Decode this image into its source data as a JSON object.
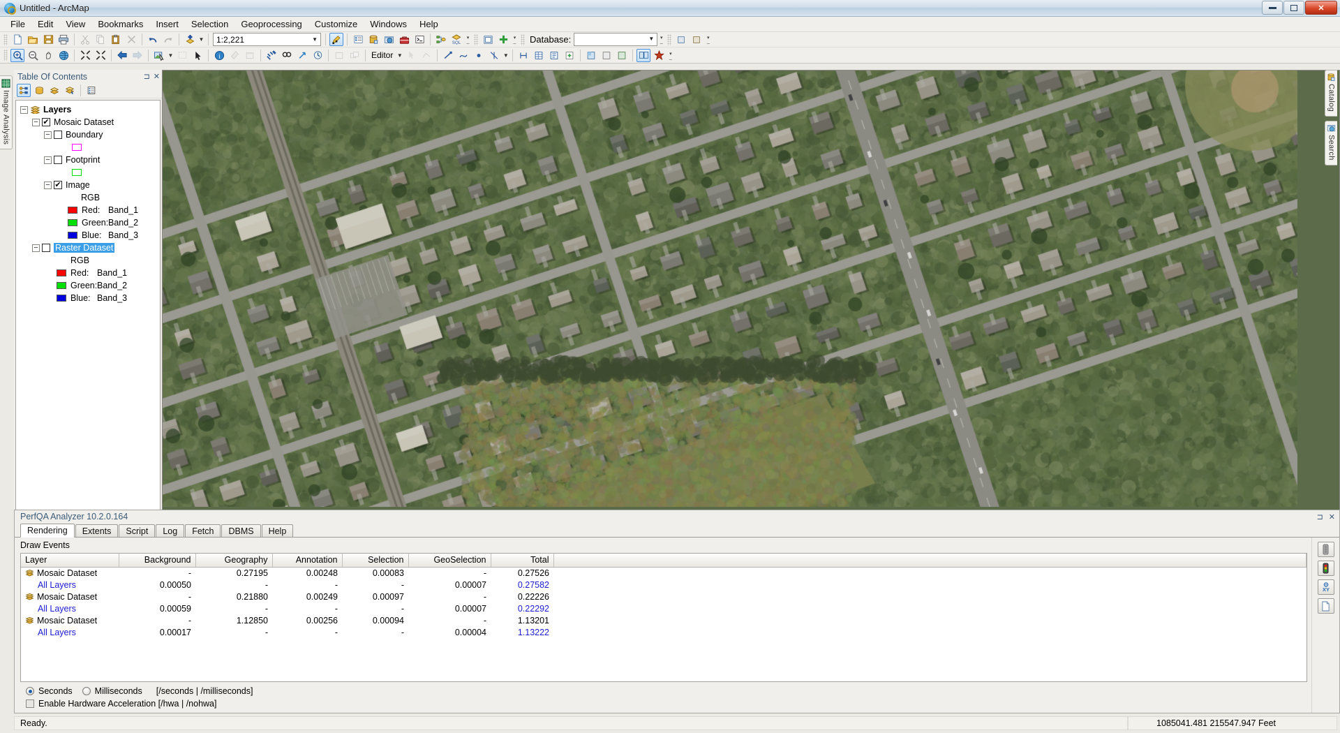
{
  "window": {
    "title": "Untitled - ArcMap",
    "app_icon": "arcmap-globe-icon",
    "minimize": "minimize-icon",
    "maximize": "restore-icon",
    "close": "✕"
  },
  "menubar": {
    "items": [
      {
        "label": "File"
      },
      {
        "label": "Edit"
      },
      {
        "label": "View"
      },
      {
        "label": "Bookmarks"
      },
      {
        "label": "Insert"
      },
      {
        "label": "Selection"
      },
      {
        "label": "Geoprocessing"
      },
      {
        "label": "Customize"
      },
      {
        "label": "Windows"
      },
      {
        "label": "Help"
      }
    ]
  },
  "toolbar_standard": {
    "scale_value": "1:2,221",
    "database_label": "Database:",
    "database_value": "",
    "buttons": [
      "new-map-icon",
      "open-icon",
      "save-icon",
      "print-icon",
      "cut-icon",
      "copy-icon",
      "paste-icon",
      "delete-icon",
      "undo-icon",
      "redo-icon",
      "add-data-icon",
      "editor-toolbar-icon",
      "table-of-contents-icon",
      "catalog-icon",
      "search-icon",
      "toolbox-icon",
      "python-window-icon",
      "model-builder-icon",
      "sql-icon",
      "layout-view-icon",
      "add-icon"
    ]
  },
  "toolbar_tools": {
    "editor_label": "Editor",
    "buttons": [
      "zoom-in-icon",
      "zoom-out-icon",
      "pan-icon",
      "full-extent-icon",
      "fixed-zoom-in-icon",
      "fixed-zoom-out-icon",
      "back-extent-icon",
      "forward-extent-icon",
      "select-features-icon",
      "clear-selection-icon",
      "select-elements-icon",
      "identify-icon",
      "hyperlink-icon",
      "html-popup-icon",
      "measure-icon",
      "find-icon",
      "go-to-xy-icon",
      "time-slider-icon",
      "create-viewer-icon",
      "swipe-icon"
    ]
  },
  "sidebar_left": {
    "tabs": [
      {
        "label": "Image Analysis",
        "icon": "image-analysis-icon"
      }
    ]
  },
  "sidebar_right": {
    "tabs": [
      {
        "label": "Catalog",
        "icon": "catalog-icon"
      },
      {
        "label": "Search",
        "icon": "search-icon"
      }
    ]
  },
  "toc": {
    "title": "Table Of Contents",
    "pin_icon": "pin-icon",
    "close_icon": "close-icon",
    "toolbar_buttons": [
      "list-by-drawing-order-icon",
      "list-by-source-icon",
      "list-by-visibility-icon",
      "list-by-selection-icon",
      "options-icon"
    ],
    "tree": [
      {
        "label": "Layers",
        "indent": 0,
        "type": "group",
        "expander": "−",
        "icon": "layers-icon",
        "bold": true
      },
      {
        "label": "Mosaic Dataset",
        "indent": 1,
        "type": "layer",
        "expander": "−",
        "checked": true
      },
      {
        "label": "Boundary",
        "indent": 2,
        "type": "layer",
        "expander": "−",
        "checked": false
      },
      {
        "label": "",
        "indent": 3,
        "type": "swatch",
        "color": "#ff00ff"
      },
      {
        "label": "Footprint",
        "indent": 2,
        "type": "layer",
        "expander": "−",
        "checked": false
      },
      {
        "label": "",
        "indent": 3,
        "type": "swatch",
        "color": "#00e000"
      },
      {
        "label": "Image",
        "indent": 2,
        "type": "layer",
        "expander": "−",
        "checked": true
      },
      {
        "label": "RGB",
        "indent": 4,
        "type": "text"
      },
      {
        "label": "Red:",
        "value": "Band_1",
        "indent": 3,
        "type": "band",
        "color": "#ff0000"
      },
      {
        "label": "Green:",
        "value": "Band_2",
        "indent": 3,
        "type": "band",
        "color": "#00e000"
      },
      {
        "label": "Blue:",
        "value": "Band_3",
        "indent": 3,
        "type": "band",
        "color": "#0000e0"
      },
      {
        "label": "Raster Dataset",
        "indent": 1,
        "type": "layer",
        "expander": "−",
        "checked": false,
        "selected": true
      },
      {
        "label": "RGB",
        "indent": 3,
        "type": "text"
      },
      {
        "label": "Red:",
        "value": "Band_1",
        "indent": 2,
        "type": "band",
        "color": "#ff0000"
      },
      {
        "label": "Green:",
        "value": "Band_2",
        "indent": 2,
        "type": "band",
        "color": "#00e000"
      },
      {
        "label": "Blue:",
        "value": "Band_3",
        "indent": 2,
        "type": "band",
        "color": "#0000e0"
      }
    ]
  },
  "perfqa": {
    "title": "PerfQA Analyzer 10.2.0.164",
    "pin_icon": "pin-icon",
    "close_icon": "close-icon",
    "tabs": [
      {
        "label": "Rendering",
        "selected": true
      },
      {
        "label": "Extents",
        "selected": false
      },
      {
        "label": "Script",
        "selected": false
      },
      {
        "label": "Log",
        "selected": false
      },
      {
        "label": "Fetch",
        "selected": false
      },
      {
        "label": "DBMS",
        "selected": false
      },
      {
        "label": "Help",
        "selected": false
      }
    ],
    "section_label": "Draw Events",
    "columns": [
      "Layer",
      "Background",
      "Geography",
      "Annotation",
      "Selection",
      "GeoSelection",
      "Total"
    ],
    "rows": [
      {
        "layer": "Mosaic Dataset",
        "icon": "mosaic-dataset-icon",
        "background": "-",
        "geography": "0.27195",
        "annotation": "0.00248",
        "selection": "0.00083",
        "geoselection": "-",
        "total": "0.27526",
        "style": "normal"
      },
      {
        "layer": "All Layers",
        "icon": "",
        "background": "0.00050",
        "geography": "-",
        "annotation": "-",
        "selection": "-",
        "geoselection": "0.00007",
        "total": "0.27582",
        "style": "all"
      },
      {
        "layer": "Mosaic Dataset",
        "icon": "mosaic-dataset-icon",
        "background": "-",
        "geography": "0.21880",
        "annotation": "0.00249",
        "selection": "0.00097",
        "geoselection": "-",
        "total": "0.22226",
        "style": "normal"
      },
      {
        "layer": "All Layers",
        "icon": "",
        "background": "0.00059",
        "geography": "-",
        "annotation": "-",
        "selection": "-",
        "geoselection": "0.00007",
        "total": "0.22292",
        "style": "all"
      },
      {
        "layer": "Mosaic Dataset",
        "icon": "mosaic-dataset-icon",
        "background": "-",
        "geography": "1.12850",
        "annotation": "0.00256",
        "selection": "0.00094",
        "geoselection": "-",
        "total": "1.13201",
        "style": "normal"
      },
      {
        "layer": "All Layers",
        "icon": "",
        "background": "0.00017",
        "geography": "-",
        "annotation": "-",
        "selection": "-",
        "geoselection": "0.00004",
        "total": "1.13222",
        "style": "all"
      }
    ],
    "units": {
      "seconds_label": "Seconds",
      "seconds_selected": true,
      "milliseconds_label": "Milliseconds",
      "milliseconds_selected": false,
      "hint": "[/seconds | /milliseconds]"
    },
    "hardware": {
      "label": "Enable Hardware Acceleration [/hwa | /nohwa]",
      "checked": false
    },
    "side_buttons": [
      "traffic-light-off-icon",
      "traffic-light-on-icon",
      "go-to-xy-icon",
      "new-document-icon"
    ]
  },
  "statusbar": {
    "message": "Ready.",
    "coordinates": "1085041.481  215547.947 Feet"
  },
  "colors": {
    "accent_blue": "#1b1bd2",
    "selection_blue": "#3b9fe8",
    "chrome": "#f0efeb",
    "toc_header_text": "#3a5a78"
  }
}
